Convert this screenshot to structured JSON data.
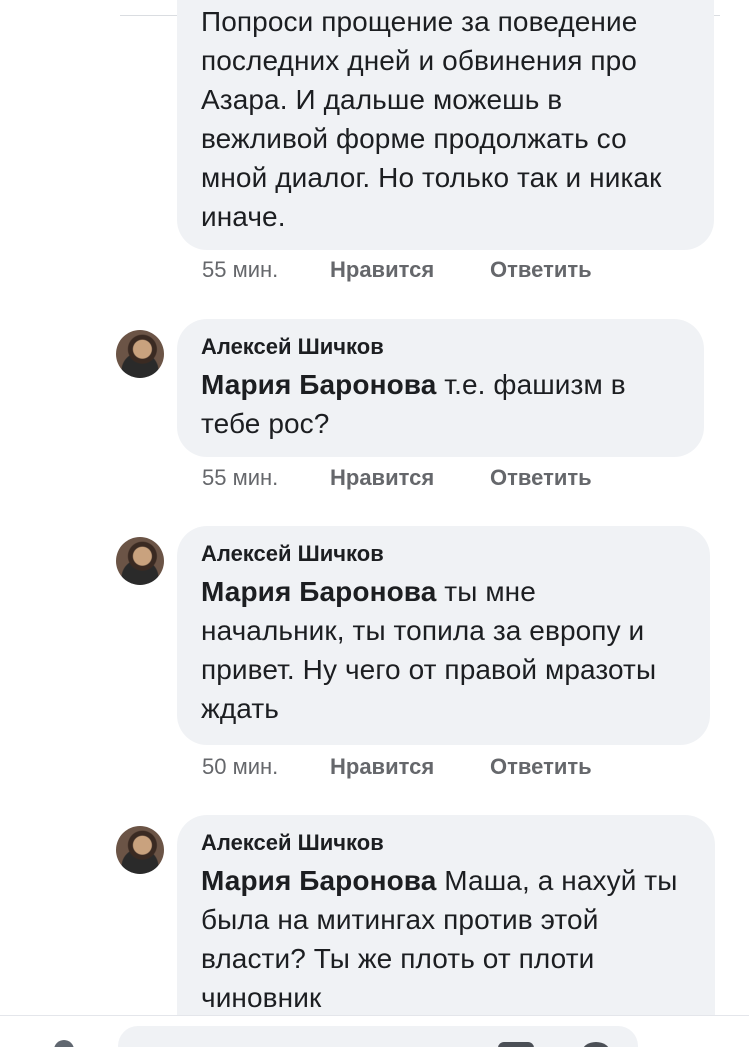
{
  "comments": [
    {
      "text_lines": "Попроси прощение за поведение последних дней и обвинения про Азара. И дальше можешь в вежливой форме продолжать со мной диалог. Но только так и никак иначе.",
      "time": "55 мин.",
      "like": "Нравится",
      "reply": "Ответить"
    },
    {
      "author": "Алексей Шичков",
      "mention": "Мария Баронова",
      "text": " т.е. фашизм в тебе рос?",
      "time": "55 мин.",
      "like": "Нравится",
      "reply": "Ответить"
    },
    {
      "author": "Алексей Шичков",
      "mention": "Мария Баронова",
      "text": " ты мне начальник, ты топила за европу и привет. Ну чего от правой мразоты ждать",
      "time": "50 мин.",
      "like": "Нравится",
      "reply": "Ответить"
    },
    {
      "author": "Алексей Шичков",
      "mention": "Мария Баронова",
      "text": " Маша, а нахуй ты была на митингах против этой власти? Ты же плоть от плоти чиновник"
    }
  ]
}
